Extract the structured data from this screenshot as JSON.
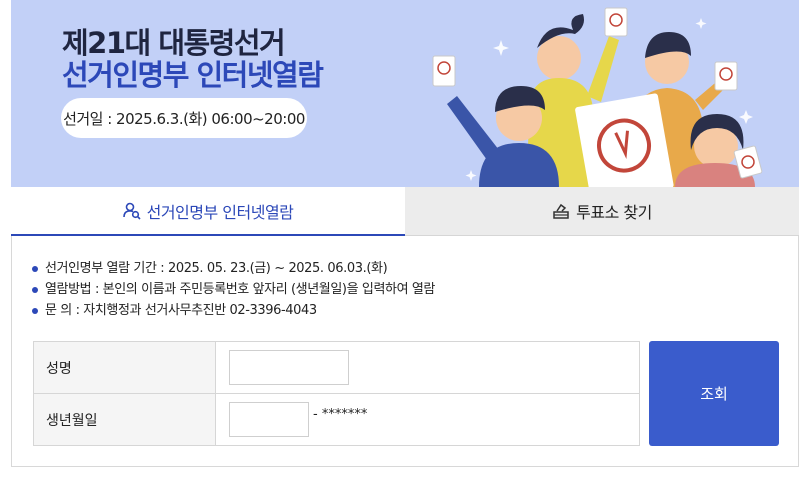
{
  "banner": {
    "title_line1": "제21대 대통령선거",
    "title_line2": "선거인명부 인터넷열람",
    "date_pill": "선거일 : 2025.6.3.(화) 06:00~20:00",
    "colors": {
      "background": "#c2d0f7",
      "title_dark": "#1f2540",
      "title_blue": "#2c48b8"
    }
  },
  "tabs": [
    {
      "label": "선거인명부 인터넷열람",
      "icon": "person-search-icon",
      "active": true
    },
    {
      "label": "투표소 찾기",
      "icon": "ballot-box-icon",
      "active": false
    }
  ],
  "info": [
    "선거인명부 열람 기간 : 2025. 05. 23.(금) ~ 2025. 06.03.(화)",
    "열람방법 : 본인의 이름과 주민등록번호 앞자리 (생년월일)을 입력하여 열람",
    "문 의 : 자치행정과 선거사무추진반 02-3396-4043"
  ],
  "form": {
    "name_label": "성명",
    "name_value": "",
    "birth_label": "생년월일",
    "birth_value": "",
    "birth_mask": "- *******"
  },
  "lookup_button": "조회",
  "accent": "#3a5ccc"
}
